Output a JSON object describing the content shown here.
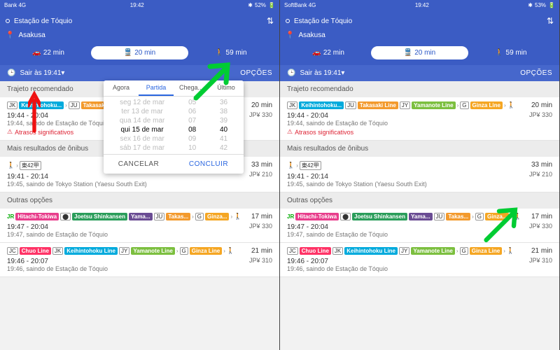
{
  "statusbar": {
    "carrier_left": "Bank 4G",
    "carrier_right": "SoftBank 4G",
    "time": "19:42",
    "bt": "",
    "batt": "52%",
    "batt_r": "53%"
  },
  "header": {
    "origin": "Estação de Tóquio",
    "destination": "Asakusa"
  },
  "modes": {
    "car": "22 min",
    "transit": "20 min",
    "walk": "59 min"
  },
  "depart": {
    "clock": "⏱",
    "label": "Sair às 19:41",
    "options": "OPÇÕES"
  },
  "sections": {
    "rec": "Trajeto recomendado",
    "bus": "Mais resultados de ônibus",
    "other": "Outras opções"
  },
  "routes": {
    "r1": {
      "badges": [
        "JK",
        "Keihintohoku...",
        "JU",
        "Takasaki Line",
        "JY",
        "Yamanote Line",
        "G",
        "Ginza Line"
      ],
      "dur": "20 min",
      "price": "JP¥ 330",
      "times": "19:44 - 20:04",
      "sub": "19:44, saindo de Estação de Tóquio",
      "delay": "Atrasos significativos"
    },
    "r2": {
      "busline": "東42甲",
      "dur": "33 min",
      "price": "JP¥ 210",
      "times": "19:41 - 20:14",
      "sub": "19:45, saindo de Tokyo Station (Yaesu South Exit)"
    },
    "r3": {
      "badges": [
        "Hitachi-Tokiwa",
        "Joetsu Shinkansen",
        "Yama...",
        "JU",
        "Takas...",
        "G",
        "Ginza..."
      ],
      "dur": "17 min",
      "price": "JP¥ 330",
      "times": "19:47 - 20:04",
      "sub": "19:47, saindo de Estação de Tóquio"
    },
    "r4": {
      "badges": [
        "JC",
        "Chuo Line",
        "JK",
        "Keihintohoku Line",
        "JY",
        "Yamanote Line",
        "G",
        "Ginza Line"
      ],
      "dur": "21 min",
      "price": "JP¥ 310",
      "times": "19:46 - 20:07",
      "sub": "19:46, saindo de Estação de Tóquio"
    }
  },
  "picker": {
    "tabs": {
      "now": "Agora",
      "depart": "Partida",
      "arrive": "Chega...",
      "last": "Último"
    },
    "days": [
      "seg 12 de mar",
      "ter 13 de mar",
      "qua 14 de mar",
      "qui 15 de mar",
      "sex 16 de mar",
      "sáb 17 de mar"
    ],
    "hours": [
      "05",
      "06",
      "07",
      "08",
      "09",
      "10"
    ],
    "mins": [
      "36",
      "38",
      "39",
      "40",
      "41",
      "42"
    ],
    "cancel": "CANCELAR",
    "done": "CONCLUIR"
  }
}
